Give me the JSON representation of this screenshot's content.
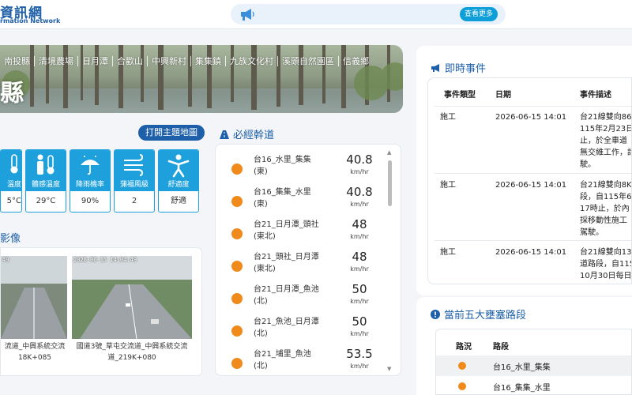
{
  "header": {
    "logo_main": "資訊網",
    "logo_sub": "rmation Network",
    "more_label": "查看更多"
  },
  "banner": {
    "nav": [
      "南投縣",
      "清境農場",
      "日月潭",
      "合歡山",
      "中興新村",
      "集集鎮",
      "九族文化村",
      "溪頭自然園區",
      "信義鄉"
    ],
    "county": "縣"
  },
  "map_button": "打開主題地圖",
  "weather": [
    {
      "icon": "thermometer-icon",
      "label": "溫度",
      "value": "5°C"
    },
    {
      "icon": "body-temp-icon",
      "label": "體感溫度",
      "value": "29°C"
    },
    {
      "icon": "umbrella-icon",
      "label": "降雨機率",
      "value": "90%"
    },
    {
      "icon": "wind-icon",
      "label": "蒲福風級",
      "value": "2"
    },
    {
      "icon": "comfort-icon",
      "label": "舒適度",
      "value": "舒適"
    }
  ],
  "cctv": {
    "title": "影像",
    "cams": [
      {
        "timestamp": "49",
        "caption_line1": "流道_中興系統交流",
        "caption_line2": "18K+085"
      },
      {
        "timestamp": "2026-06-15 14:04:49",
        "caption_line1": "國道3號_草屯交流道_中興系統交流",
        "caption_line2": "道_219K+080"
      }
    ]
  },
  "highway": {
    "title": "必經幹道",
    "rows": [
      {
        "route": "台16_水里_集集",
        "dir": "(東)",
        "speed": "40.8",
        "unit": "km/hr"
      },
      {
        "route": "台16_集集_水里",
        "dir": "(東)",
        "speed": "40.8",
        "unit": "km/hr"
      },
      {
        "route": "台21_日月潭_頭社",
        "dir": "(東北)",
        "speed": "48",
        "unit": "km/hr"
      },
      {
        "route": "台21_頭社_日月潭",
        "dir": "(東北)",
        "speed": "48",
        "unit": "km/hr"
      },
      {
        "route": "台21_日月潭_魚池",
        "dir": "(北)",
        "speed": "50",
        "unit": "km/hr"
      },
      {
        "route": "台21_魚池_日月潭",
        "dir": "(北)",
        "speed": "50",
        "unit": "km/hr"
      },
      {
        "route": "台21_埔里_魚池",
        "dir": "(北)",
        "speed": "53.5",
        "unit": "km/hr"
      }
    ]
  },
  "realtime": {
    "title": "即時事件",
    "headers": {
      "type": "事件類型",
      "date": "日期",
      "desc": "事件描述"
    },
    "events": [
      {
        "type": "施工",
        "date": "2026-06-15 14:01",
        "desc": [
          "台21線雙向86K",
          "115年2月23日",
          "止，於全車道",
          "無交維工作，請",
          "駛。"
        ]
      },
      {
        "type": "施工",
        "date": "2026-06-15 14:01",
        "desc": [
          "台21線雙向8K",
          "段，自115年6月",
          "17時止，於內",
          "採移動性施工",
          "駕駛。"
        ]
      },
      {
        "type": "施工",
        "date": "2026-06-15 14:01",
        "desc": [
          "台21線雙向13",
          "道路段，自115",
          "10月30日每日"
        ]
      }
    ]
  },
  "jam": {
    "title": "當前五大壅塞路段",
    "headers": {
      "status": "路況",
      "road": "路段"
    },
    "rows": [
      {
        "road": "台16_水里_集集"
      },
      {
        "road": "台16_集集_水里"
      }
    ]
  },
  "colors": {
    "brand": "#1d5fa8",
    "accent": "#1ea0dc",
    "status_orange": "#f08a1b"
  }
}
